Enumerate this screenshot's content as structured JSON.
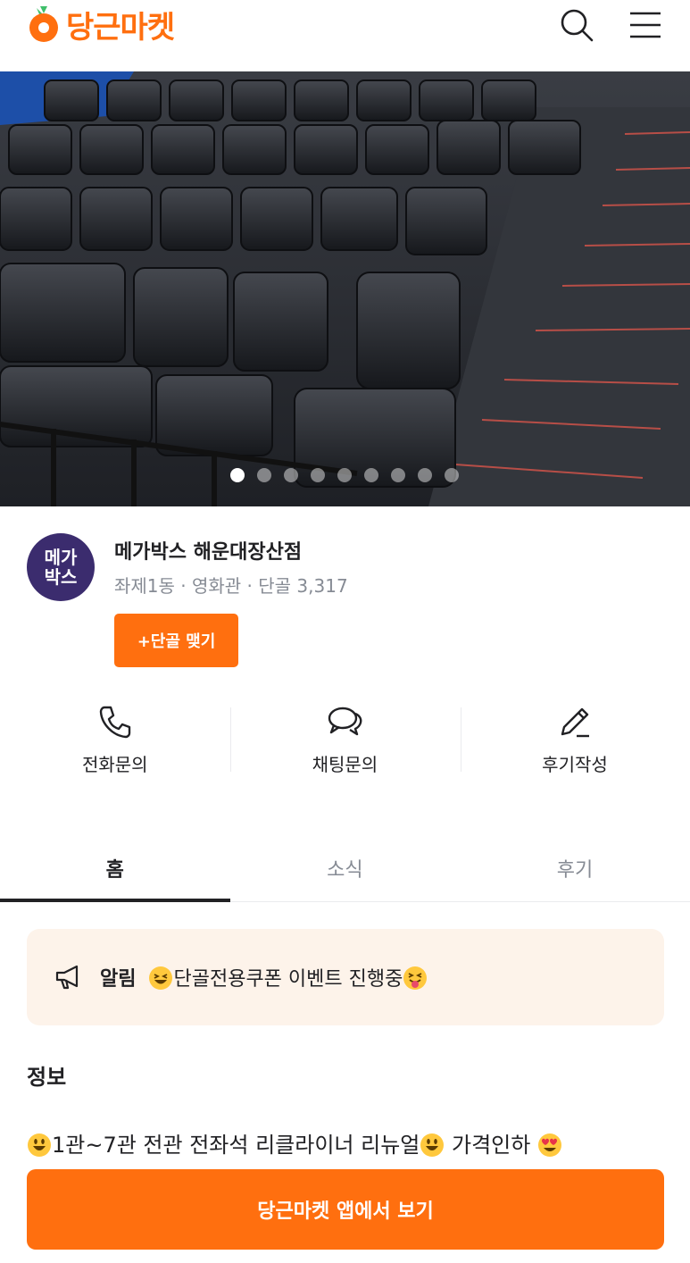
{
  "header": {
    "logo_text": "당근마켓",
    "brand_color": "#FF6F0F",
    "icons": [
      "search-icon",
      "menu-icon"
    ]
  },
  "hero": {
    "slide_count": 9,
    "active_slide": 1
  },
  "store": {
    "avatar_line1": "메가",
    "avatar_line2": "박스",
    "name": "메가박스 해운대장산점",
    "meta": "좌제1동 · 영화관 · 단골 3,317",
    "follow_label": "+단골 맺기"
  },
  "actions": {
    "call": "전화문의",
    "chat": "채팅문의",
    "review": "후기작성"
  },
  "tabs": {
    "home": "홈",
    "news": "소식",
    "reviews": "후기"
  },
  "notice": {
    "label": "알림",
    "text": "단골전용쿠폰 이벤트 진행중"
  },
  "info": {
    "title": "정보",
    "part1": "1관~7관 전관 전좌석 리클라이너 리뉴얼",
    "part2": " 가격인하 "
  },
  "cta": {
    "label": "당근마켓 앱에서 보기"
  }
}
